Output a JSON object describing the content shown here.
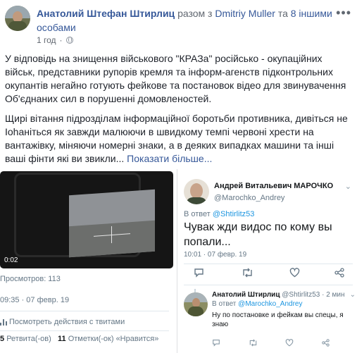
{
  "post": {
    "author": "Анатолий Штефан Штирлиц",
    "with_text": "разом з",
    "tagged_user": "Dmitriy Muller",
    "and_text": "та",
    "others_link": "8 іншими особами",
    "time_ago": "1 год",
    "paragraph1": "У відповідь на знищення військового \"КРАЗа\" російсько - окупаційних військ, представники рупорів кремля та інформ-агенств підконтрольних окупантів негайно готують фейкове та постановок відео для звинувачення Об'єднаних сил в порушенні домовленостей.",
    "paragraph2": "Щирі вітання підрозділам інформаційної боротьби противника, дивіться не Іоhаніться як завжди малюючи в швидкому темпі червоні хрести на вантажівку, міняючи номерні знаки, а в деяких випадках машини та інші ваші фінти які ви звикли...",
    "see_more": "Показати більше...",
    "more_icon": "ellipsis-icon"
  },
  "left_tweet": {
    "video_time": "0:02",
    "views": "Просмотров: 113",
    "time": "09:35 · 07 февр. 19",
    "activity": "Посмотреть действия с твитами",
    "retweets_count": "5",
    "retweets_label": "Ретвита(-ов)",
    "likes_count": "11",
    "likes_label": "Отметки(-ок) «Нравится»"
  },
  "right_tweet": {
    "name": "Андрей Витальевич МАРОЧКО",
    "handle": "@Marochko_Andrey",
    "reply_prefix": "В ответ",
    "reply_handle": "@Shtirlitz53",
    "text": "Чувак жди видос по кому вы попали...",
    "time": "10:01 · 07 февр. 19"
  },
  "reply_tweet": {
    "name": "Анатолий Штирлиц",
    "handle_time": "@Shtirlitz53 · 2 мин",
    "reply_prefix": "В ответ",
    "reply_handle": "@Marochko_Andrey",
    "text": "Ну по постановке и фейкам вы спецы, я знаю"
  },
  "icons": {
    "reply": "reply-icon",
    "retweet": "retweet-icon",
    "like": "heart-icon",
    "share": "share-icon"
  },
  "colors": {
    "fb_link": "#365899",
    "twitter_link": "#1b95e0",
    "muted": "#657786"
  }
}
